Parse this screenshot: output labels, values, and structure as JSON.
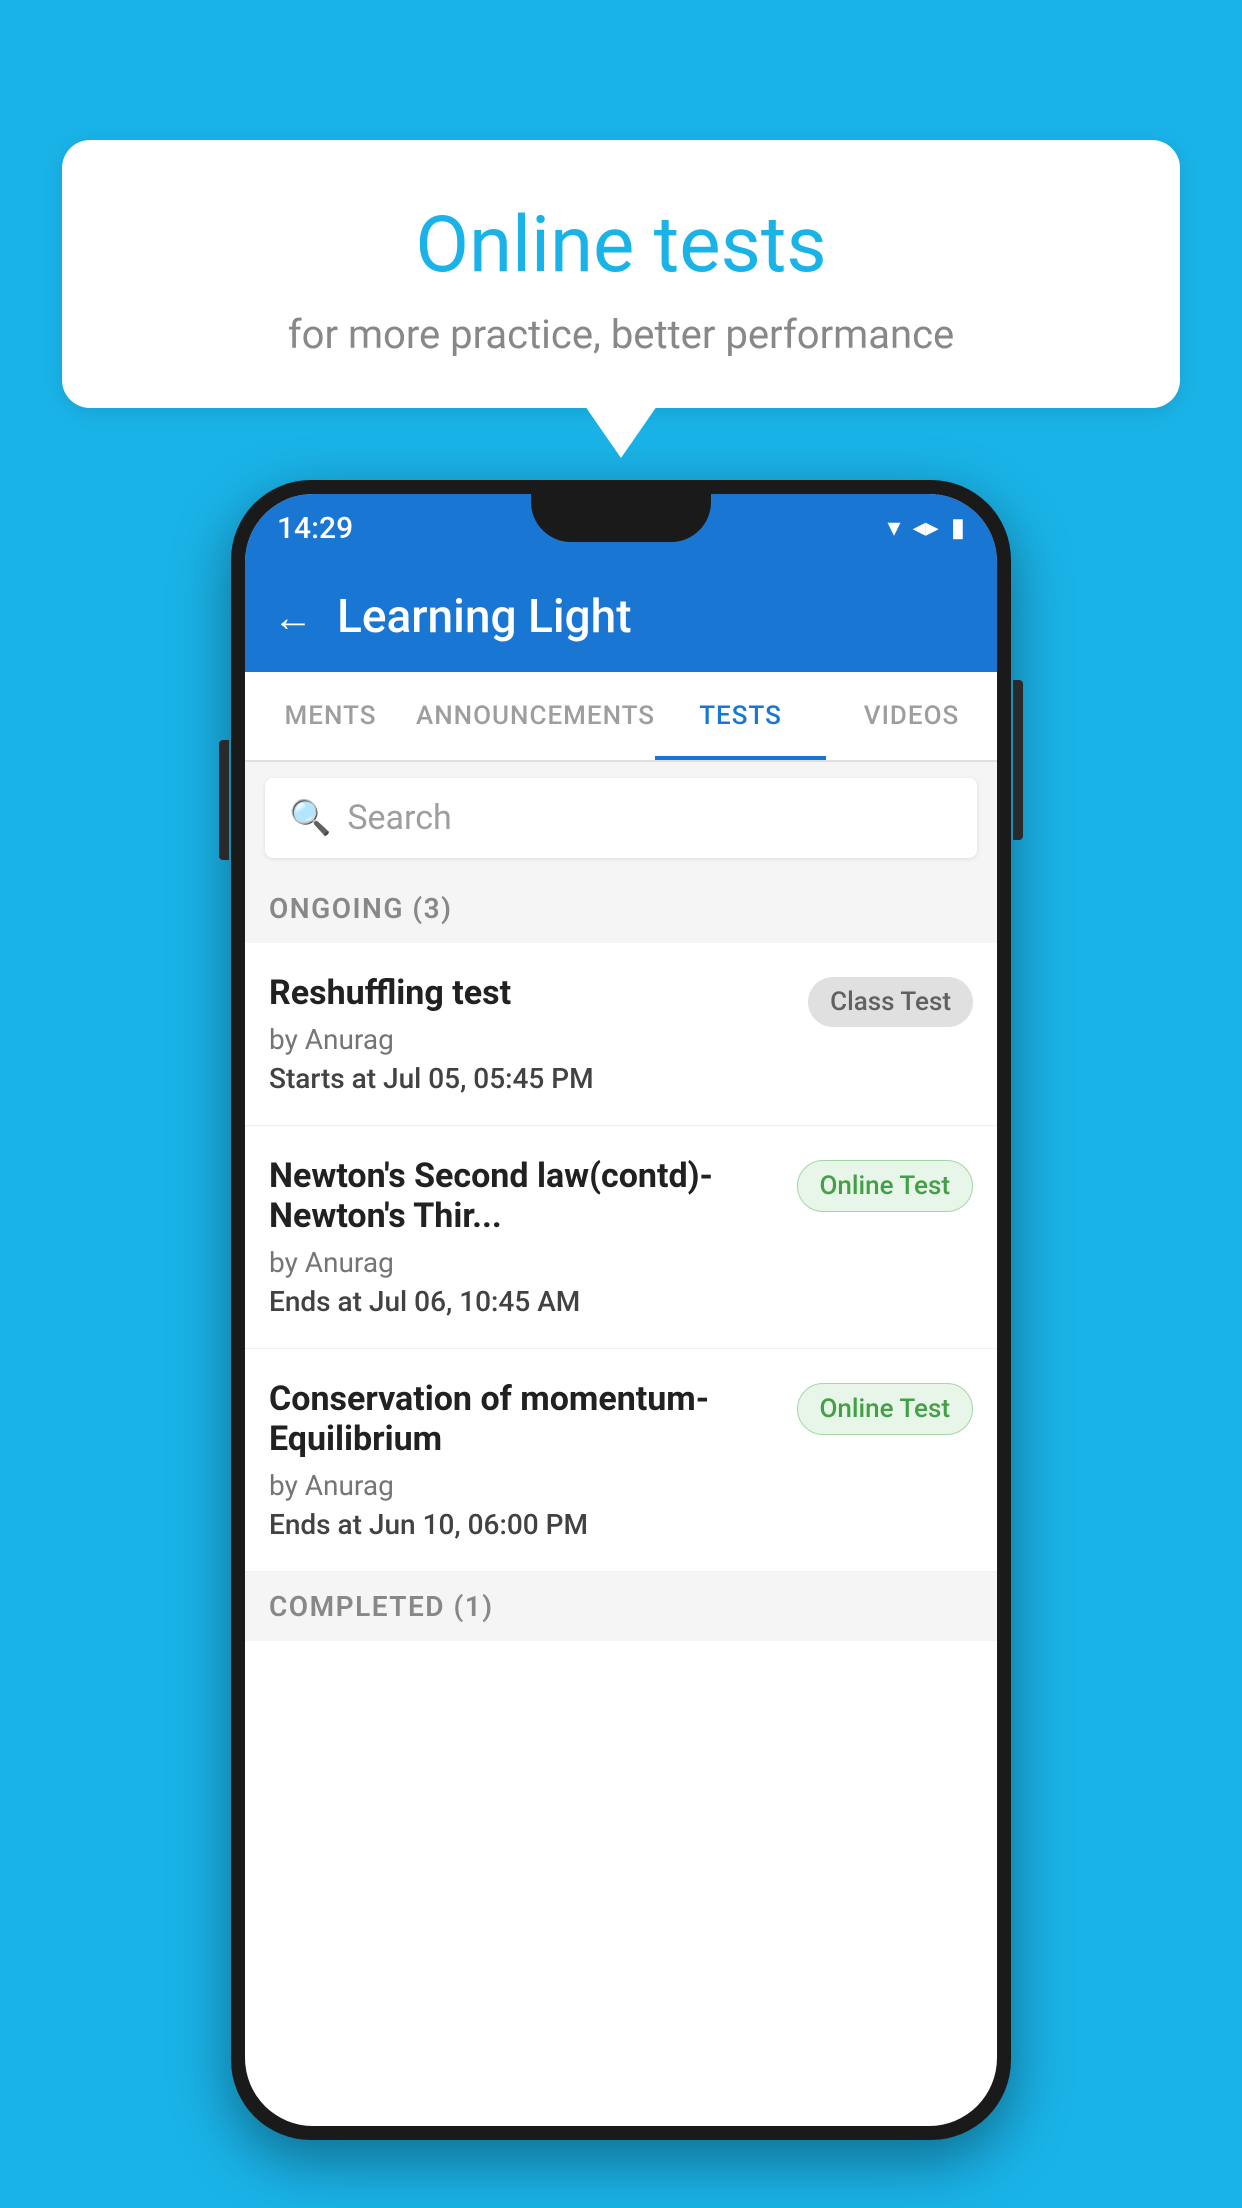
{
  "background_color": "#1ab3e8",
  "speech_bubble": {
    "title": "Online tests",
    "subtitle": "for more practice, better performance"
  },
  "phone": {
    "status_bar": {
      "time": "14:29",
      "icons": [
        "wifi",
        "signal",
        "battery"
      ]
    },
    "app_bar": {
      "title": "Learning Light",
      "back_label": "←"
    },
    "tabs": [
      {
        "label": "MENTS",
        "active": false
      },
      {
        "label": "ANNOUNCEMENTS",
        "active": false
      },
      {
        "label": "TESTS",
        "active": true
      },
      {
        "label": "VIDEOS",
        "active": false
      }
    ],
    "search": {
      "placeholder": "Search"
    },
    "ongoing_section": {
      "header": "ONGOING (3)",
      "items": [
        {
          "name": "Reshuffling test",
          "author": "by Anurag",
          "time_label": "Starts at",
          "time_value": "Jul 05, 05:45 PM",
          "badge": "Class Test",
          "badge_type": "class"
        },
        {
          "name": "Newton's Second law(contd)-Newton's Thir...",
          "author": "by Anurag",
          "time_label": "Ends at",
          "time_value": "Jul 06, 10:45 AM",
          "badge": "Online Test",
          "badge_type": "online"
        },
        {
          "name": "Conservation of momentum-Equilibrium",
          "author": "by Anurag",
          "time_label": "Ends at",
          "time_value": "Jun 10, 06:00 PM",
          "badge": "Online Test",
          "badge_type": "online"
        }
      ]
    },
    "completed_section": {
      "header": "COMPLETED (1)"
    }
  }
}
